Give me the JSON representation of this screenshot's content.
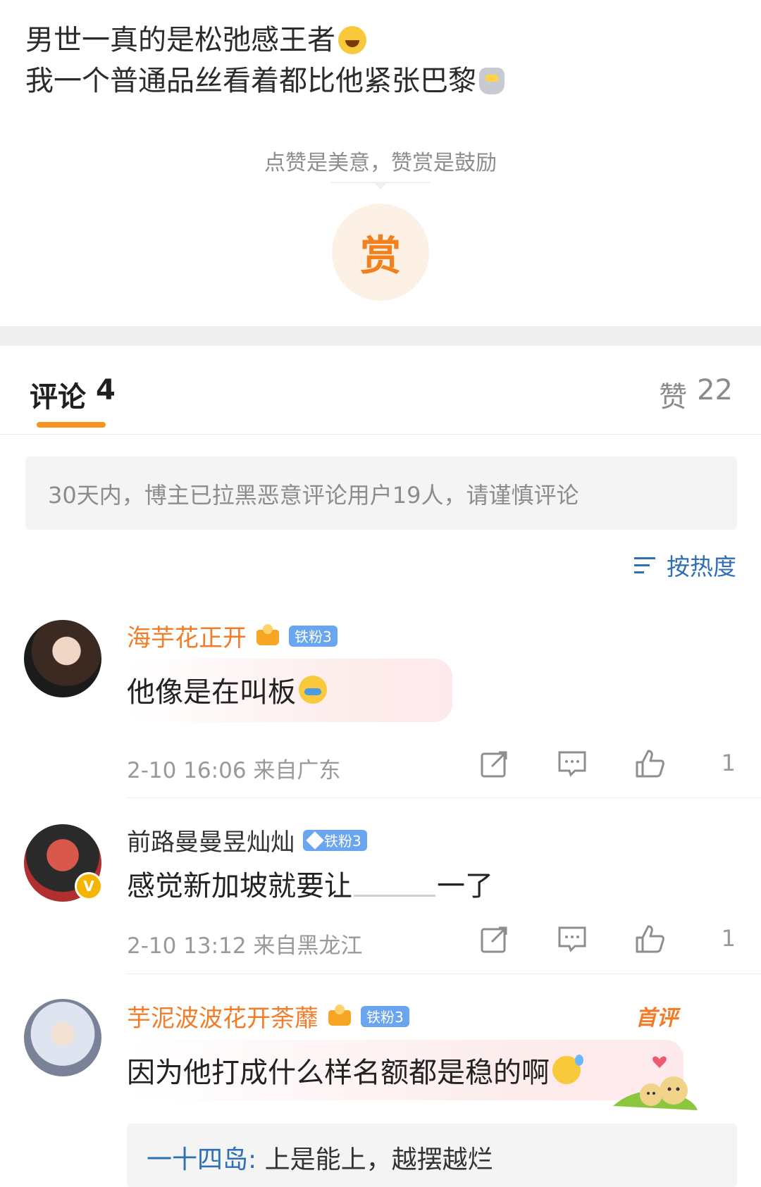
{
  "post": {
    "line1": "男世一真的是松弛感王者",
    "line2": "我一个普通品丝看着都比他紧张巴黎",
    "emoji_line1": "laughing-tears-emoji",
    "emoji_line2": "robot-emoji"
  },
  "reward": {
    "hint": "点赞是美意，赞赏是鼓励",
    "button": "赏"
  },
  "tabs": {
    "comments_label": "评论",
    "comments_count": "4",
    "likes_label": "赞",
    "likes_count": "22"
  },
  "notice": "30天内，博主已拉黑恶意评论用户19人，请谨慎评论",
  "sort": {
    "label": "按热度"
  },
  "comments": [
    {
      "user": "海芋花正开",
      "badge": "铁粉3",
      "text": "他像是在叫板",
      "meta": "2-10 16:06 来自广东",
      "likes": "1"
    },
    {
      "user": "前路曼曼昱灿灿",
      "badge": "铁粉3",
      "text": "感觉新加坡就要让",
      "text_tail": "一了",
      "meta": "2-10 13:12 来自黑龙江",
      "likes": "1"
    },
    {
      "user": "芋泥波波花开荼蘼",
      "badge": "铁粉3",
      "tag": "首评",
      "text": "因为他打成什么样名额都是稳的啊",
      "reply_user": "一十四岛",
      "reply_text": "上是能上，越摆越烂"
    }
  ],
  "colors": {
    "accent_orange": "#f7931e",
    "username_orange": "#f17d2a",
    "link_blue": "#2f6fb6"
  }
}
